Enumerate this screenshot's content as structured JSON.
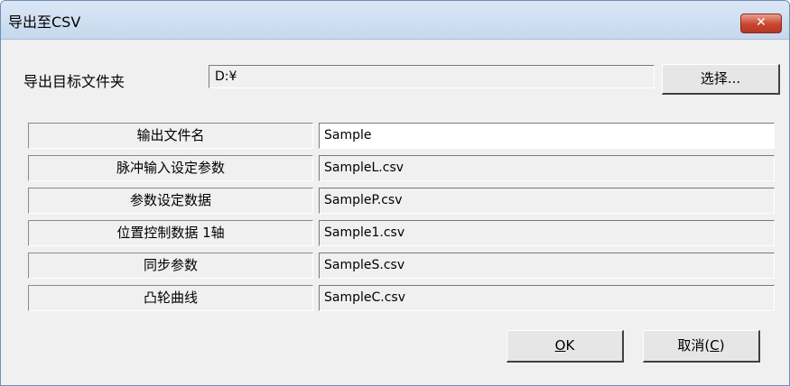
{
  "window": {
    "title": "导出至CSV",
    "close_glyph": "✕"
  },
  "folder": {
    "label": "导出目标文件夹",
    "value": "D:¥",
    "select_button": "选择..."
  },
  "rows": [
    {
      "label": "输出文件名",
      "value": "Sample"
    },
    {
      "label": "脉冲输入设定参数",
      "value": "SampleL.csv"
    },
    {
      "label": "参数设定数据",
      "value": "SampleP.csv"
    },
    {
      "label": "位置控制数据 1轴",
      "value": "Sample1.csv"
    },
    {
      "label": "同步参数",
      "value": "SampleS.csv"
    },
    {
      "label": "凸轮曲线",
      "value": "SampleC.csv"
    }
  ],
  "buttons": {
    "ok_hotkey": "O",
    "ok_rest": "K",
    "cancel_prefix": "取消(",
    "cancel_hotkey": "C",
    "cancel_suffix": ")"
  }
}
